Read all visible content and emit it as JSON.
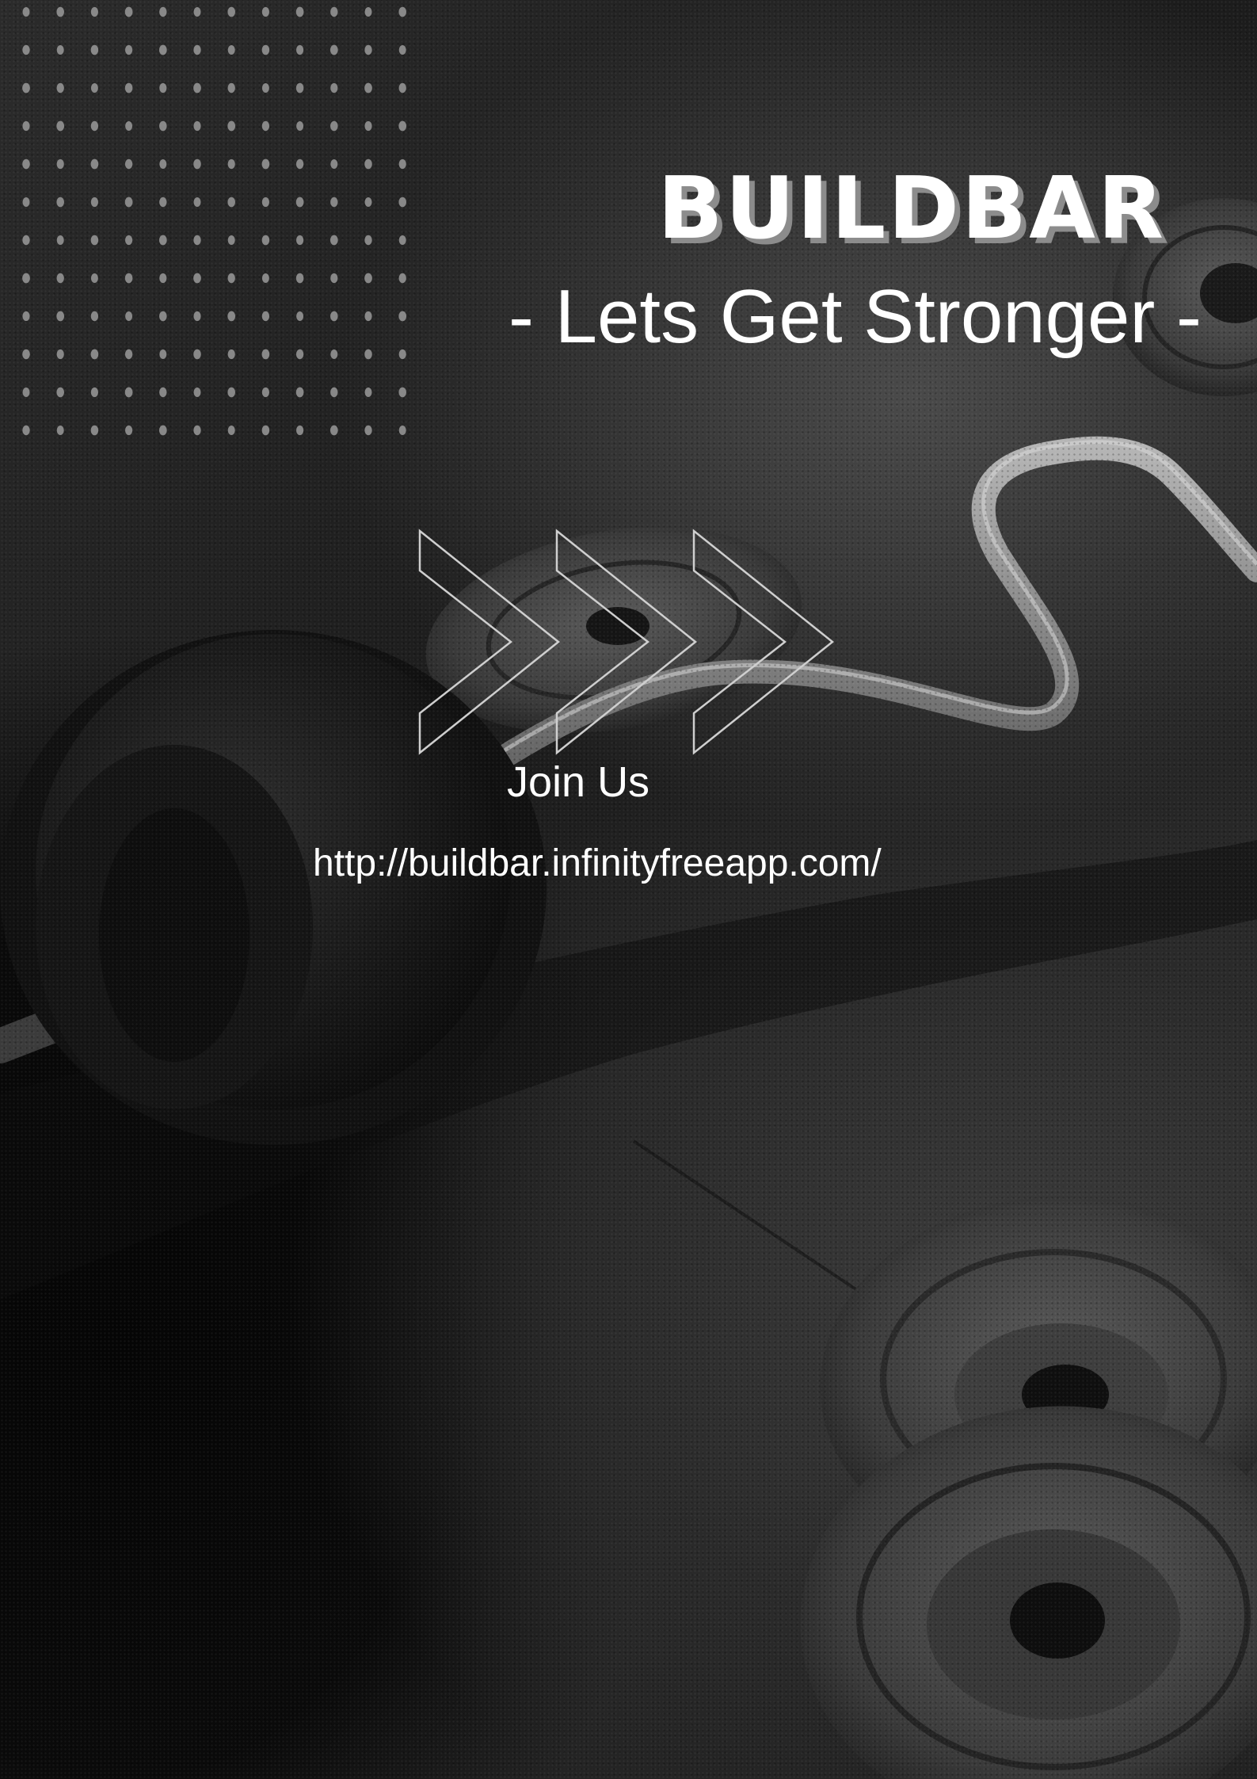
{
  "poster": {
    "title": "BUILDBAR",
    "tagline": "- Lets Get Stronger -",
    "cta_label": "Join Us",
    "url": "http://buildbar.infinityfreeapp.com/"
  },
  "background": {
    "description_icon": "barbell-photo",
    "plate_icon": "weight-plate-icon",
    "chevron_icon": "triple-chevron-icon"
  },
  "colors": {
    "title_text": "#ffffff",
    "title_shadow": "#8c8c8c",
    "dots": "#9a9a9a",
    "chevrons": "#cfcfcf"
  }
}
